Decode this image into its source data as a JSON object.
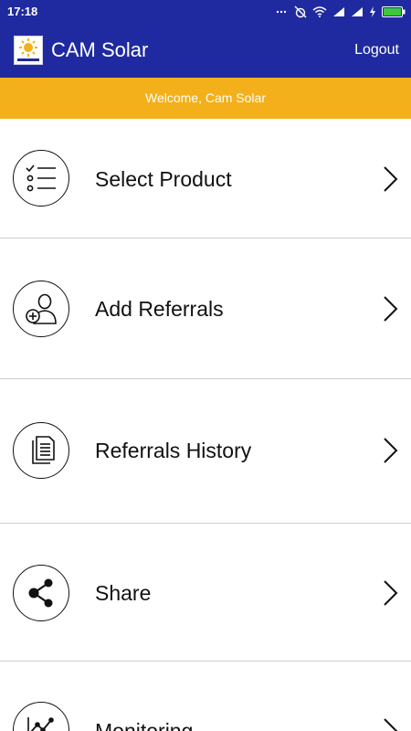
{
  "status_bar": {
    "time": "17:18",
    "icons": [
      "signal-icon",
      "alarm-off-icon",
      "wifi-icon",
      "cell-signal-icon",
      "cell-signal-icon",
      "charging-icon",
      "battery-icon"
    ]
  },
  "header": {
    "logo_icon": "cam-solar-logo",
    "title": "CAM Solar",
    "logout_label": "Logout",
    "background": "#1f2aa0"
  },
  "welcome": {
    "text": "Welcome, Cam Solar",
    "background": "#f3b01a"
  },
  "menu": {
    "items": [
      {
        "label": "Select Product",
        "icon": "checklist-icon"
      },
      {
        "label": "Add Referrals",
        "icon": "add-user-icon"
      },
      {
        "label": "Referrals History",
        "icon": "documents-icon"
      },
      {
        "label": "Share",
        "icon": "share-icon"
      },
      {
        "label": "Monitoring",
        "icon": "line-chart-icon"
      }
    ],
    "chevron_icon": "chevron-right-icon"
  }
}
